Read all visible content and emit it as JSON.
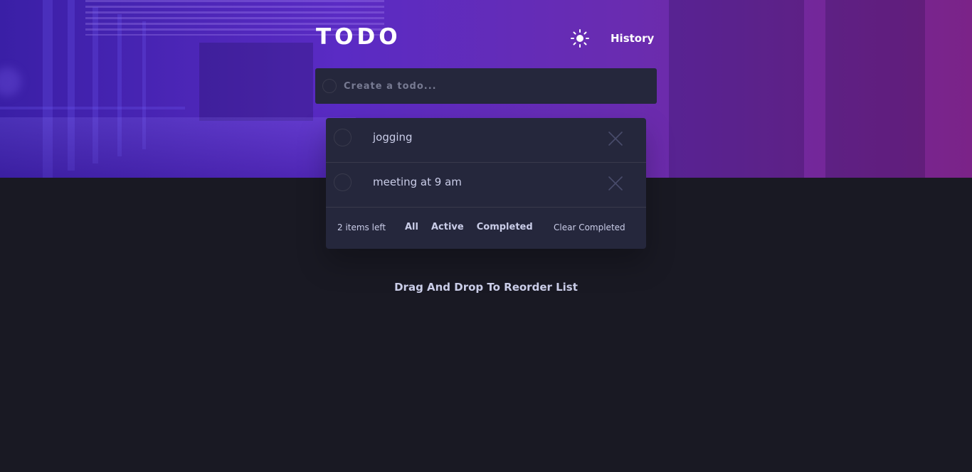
{
  "header": {
    "logo": "TODO",
    "theme_icon": "sun-icon",
    "history_label": "History"
  },
  "create": {
    "placeholder": "Create a todo..."
  },
  "todos": [
    {
      "text": "jogging",
      "completed": false
    },
    {
      "text": "meeting at 9 am",
      "completed": false
    }
  ],
  "footer": {
    "items_left": "2 items left",
    "filters": [
      "All",
      "Active",
      "Completed"
    ],
    "clear_label": "Clear Completed"
  },
  "hint": "Drag And Drop To Reorder List",
  "colors": {
    "background": "#191923",
    "card": "#25273c",
    "text": "#cacde8",
    "muted": "#777a92",
    "border": "#393a4c"
  }
}
